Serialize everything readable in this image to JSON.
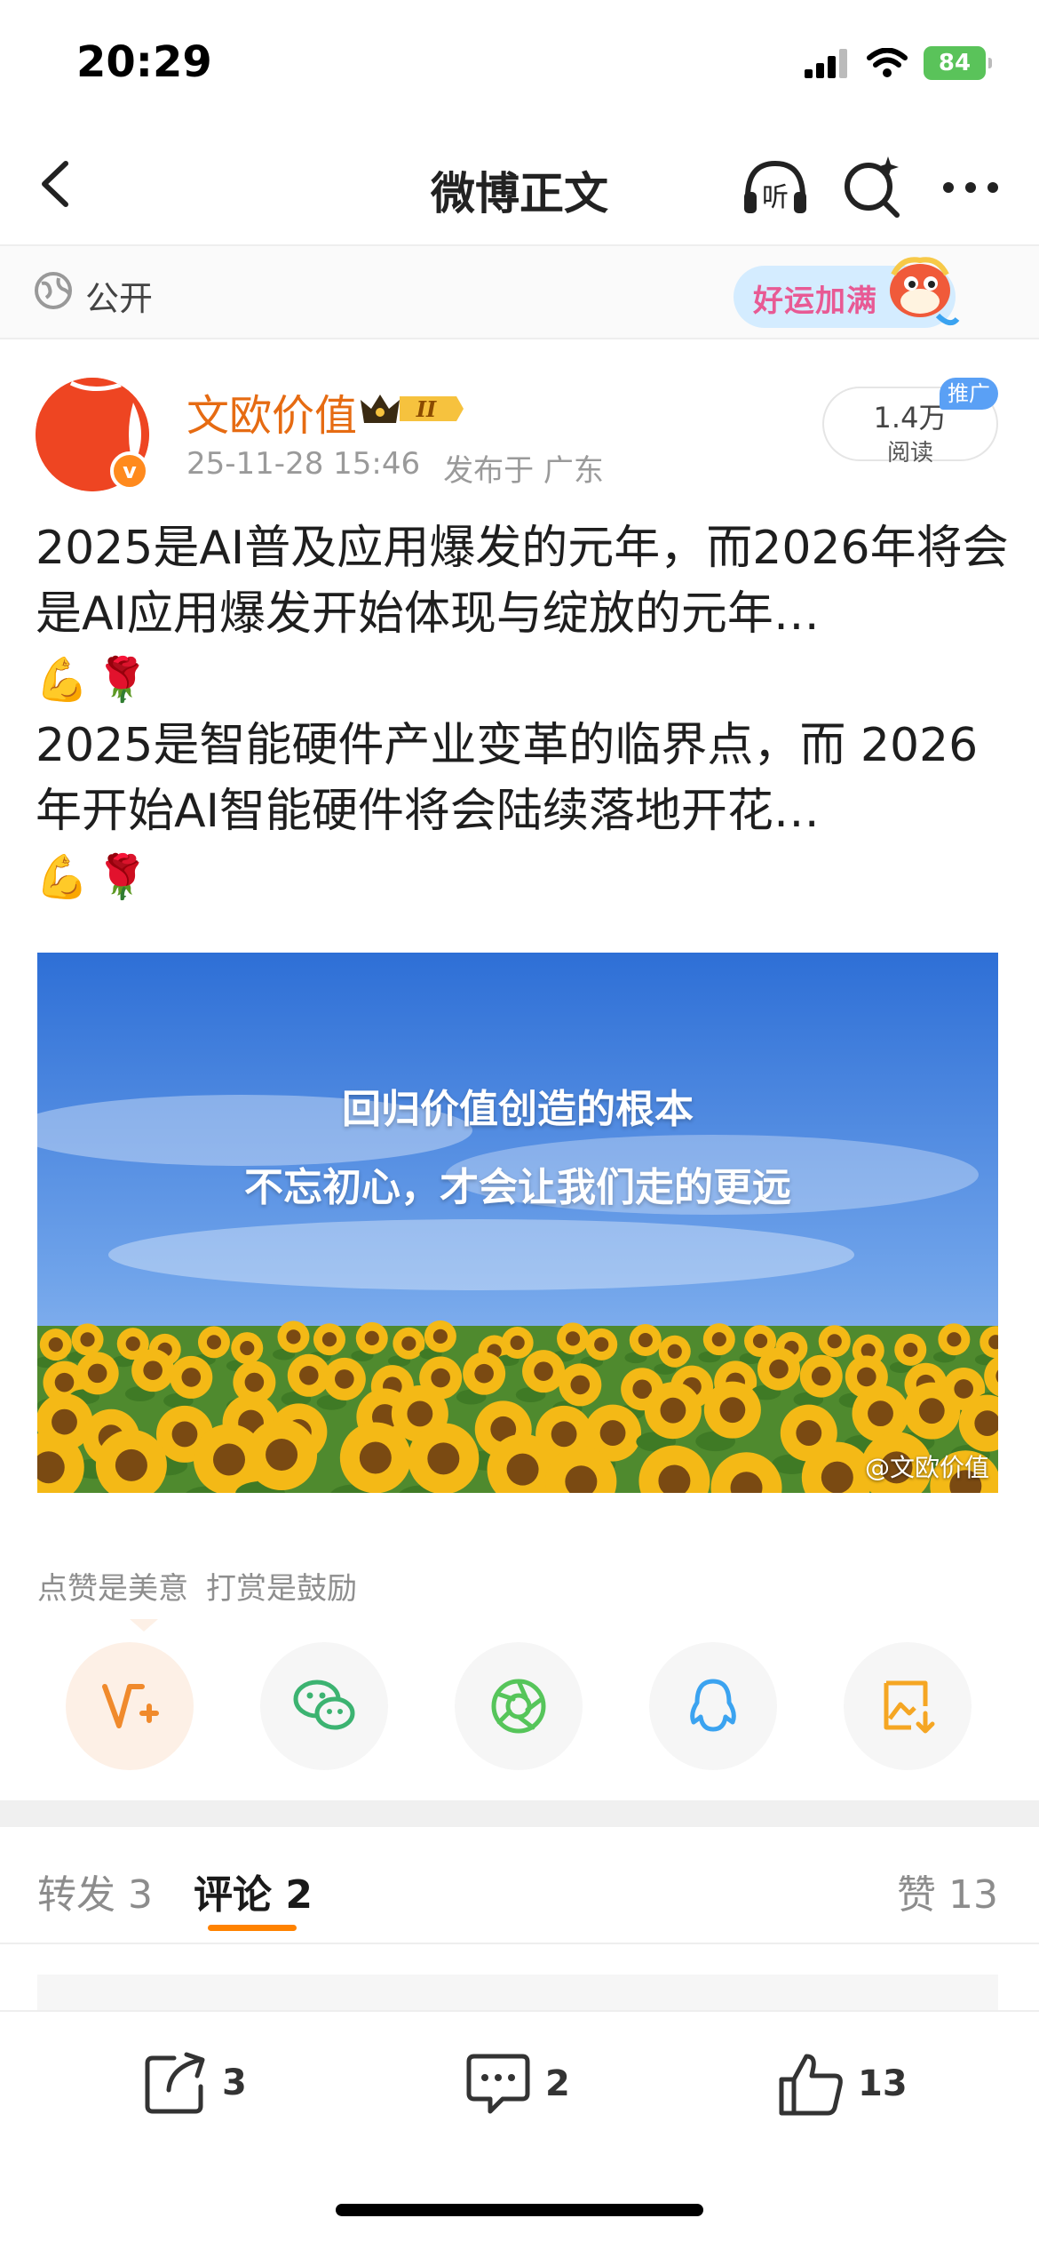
{
  "status_bar": {
    "time": "20:29",
    "battery": "84"
  },
  "nav": {
    "title": "微博正文",
    "listen_label": "听"
  },
  "visibility": {
    "label": "公开",
    "banner_text": "好运加满"
  },
  "author": {
    "avatar_badge": "v",
    "name": "文欧价值",
    "vip_level": "II",
    "date": "25-11-28 15:46",
    "location": "发布于 广东"
  },
  "read_stats": {
    "count": "1.4万",
    "label": "阅读",
    "promo": "推广"
  },
  "post": {
    "line1": "2025是AI普及应用爆发的元年，而2026年将会是AI应用爆发开始体现与绽放的元年…",
    "line2": "2025是智能硬件产业变革的临界点，而 2026年开始AI智能硬件将会陆续落地开花…",
    "emoji": {
      "arm": "💪",
      "rose": "🌹"
    }
  },
  "image": {
    "caption1": "回归价值创造的根本",
    "caption2": "不忘初心，才会让我们走的更远",
    "watermark": "@文欧价值"
  },
  "appreciation": {
    "text1": "点赞是美意",
    "text2": "打赏是鼓励"
  },
  "tabs": {
    "repost": "转发 3",
    "comment": "评论 2",
    "like": "赞 13"
  },
  "actions": {
    "repost_count": "3",
    "comment_count": "2",
    "like_count": "13"
  },
  "colors": {
    "accent": "#ff8200",
    "author": "#e66b12",
    "wechat": "#3cb371",
    "moments": "#56c55a",
    "qq": "#3ba3f0",
    "save": "#f5a623"
  }
}
